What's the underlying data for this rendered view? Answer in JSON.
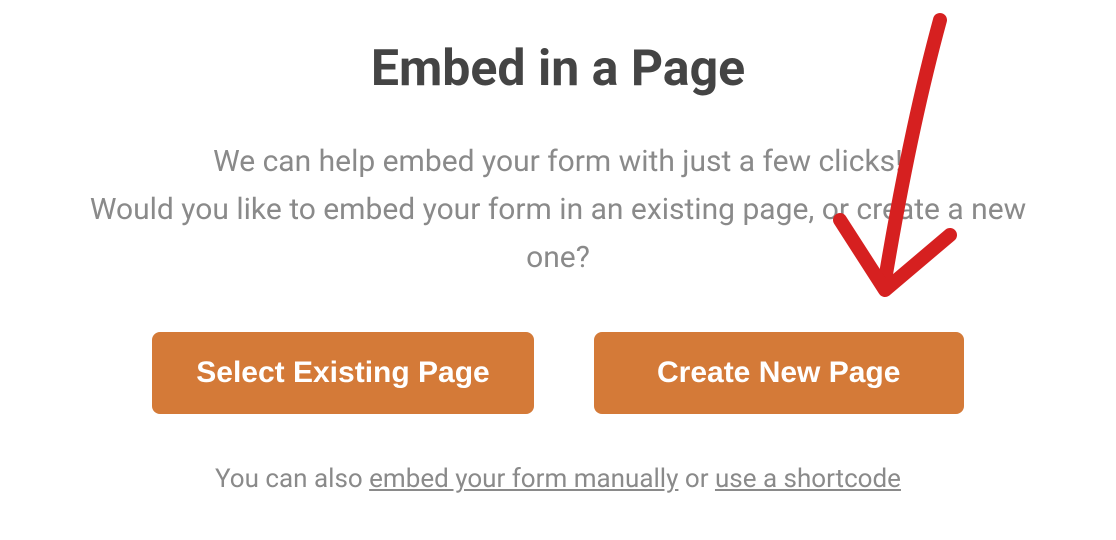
{
  "title": "Embed in a Page",
  "description_line1": "We can help embed your form with just a few clicks!",
  "description_line2": "Would you like to embed your form in an existing page, or create a new one?",
  "buttons": {
    "select_existing": "Select Existing Page",
    "create_new": "Create New Page"
  },
  "footer": {
    "prefix": "You can also ",
    "link1": "embed your form manually",
    "middle": " or ",
    "link2": "use a shortcode"
  },
  "colors": {
    "button_bg": "#d47a38",
    "title": "#444444",
    "text": "#8a8a8a",
    "annotation": "#d62020"
  }
}
